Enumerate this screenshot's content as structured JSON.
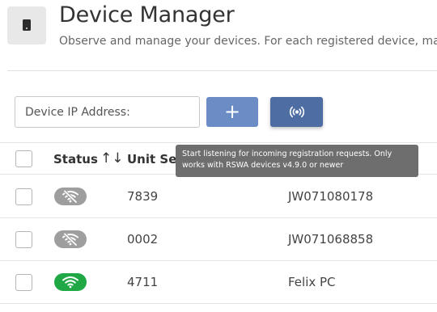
{
  "header": {
    "title": "Device Manager",
    "subtitle": "Observe and manage your devices. For each registered device, man"
  },
  "toolbar": {
    "ip_placeholder": "Device IP Address:",
    "add_label": "+",
    "listen_icon": "broadcast-icon"
  },
  "tooltip": {
    "text": "Start listening for incoming registration requests. Only works with RSWA devices v4.9.0 or newer"
  },
  "table": {
    "columns": {
      "status": "Status",
      "unit": "Unit Ser"
    },
    "sort_icon": "↑↓",
    "rows": [
      {
        "status": "offline",
        "unit": "7839",
        "name": "JW071080178"
      },
      {
        "status": "offline",
        "unit": "0002",
        "name": "JW071068858"
      },
      {
        "status": "online",
        "unit": "4711",
        "name": "Felix PC"
      }
    ]
  },
  "colors": {
    "primary": "#6b8cc4",
    "primary_dark": "#4e6da3",
    "online": "#1fa845",
    "offline": "#9e9e9e",
    "tooltip": "#6e6e6e"
  }
}
